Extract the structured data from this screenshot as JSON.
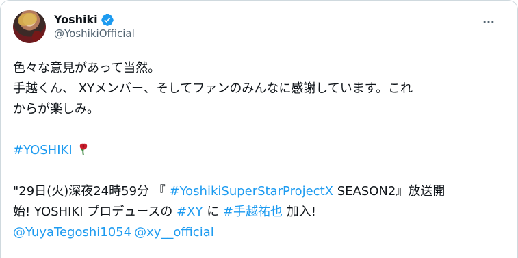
{
  "user": {
    "display_name": "Yoshiki",
    "handle": "@YoshikiOfficial",
    "verified_icon": "verified-badge-icon"
  },
  "menu": {
    "more_icon": "more-options-icon",
    "more_label": "..."
  },
  "tweet": {
    "line1": "色々な意見があって当然。",
    "line2": "手越くん、 XYメンバー、そしてファンのみんなに感謝しています。これ",
    "line3": "からが楽しみ。",
    "hashtag": "#YOSHIKI",
    "rose_icon": "rose-icon",
    "line5_prefix": "\"29日(火)深夜24時59分 『 ",
    "line5_link": "#YoshikiSuperStarProjectX",
    "line5_suffix": " SEASON2』放送開",
    "line6_prefix": "始! YOSHIKI プロデュースの ",
    "line6_link1": "#XY",
    "line6_mid": " に ",
    "line6_link2": "#手越祐也",
    "line6_suffix": " 加入!",
    "mention1": "@YuyaTegoshi1054",
    "mention2": "@xy__official"
  },
  "colors": {
    "text": "#0f1419",
    "secondary": "#536471",
    "link": "#1d9bf0",
    "verified": "#1d9bf0"
  }
}
